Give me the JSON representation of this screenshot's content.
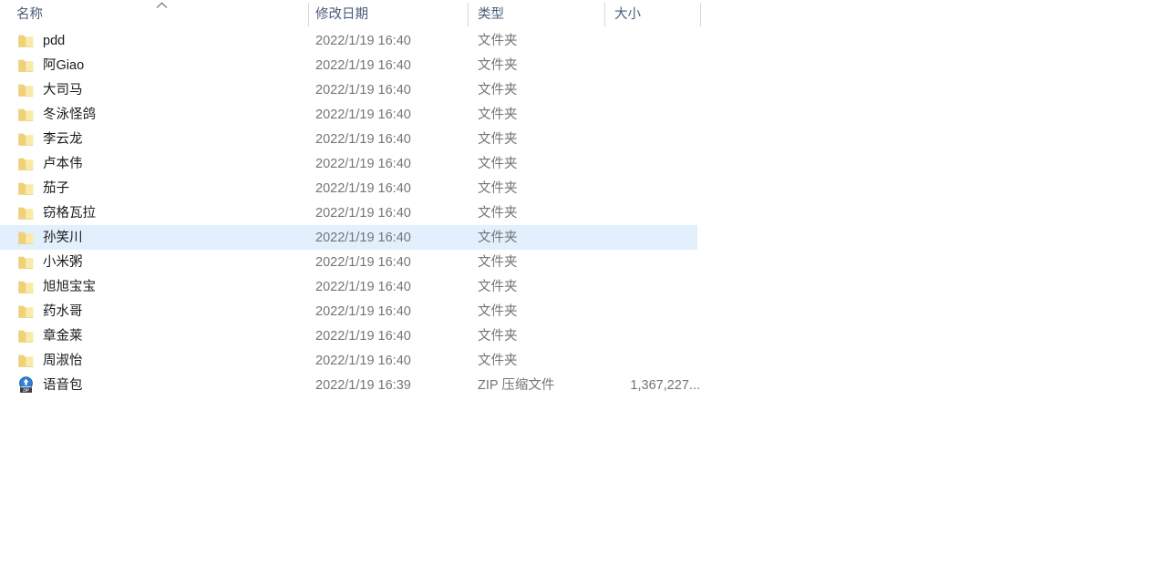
{
  "view": {
    "name": "details-list-view",
    "background_color": "#ffffff",
    "selection_color": "#e2effc",
    "header_text_color": "#4b5c78",
    "name_text_color": "#191919",
    "meta_text_color": "#757575",
    "folder_icon_color": "#f5d97b",
    "zip_icon_color": "#1f6fd0"
  },
  "columns": [
    {
      "key": "name",
      "label": "名称",
      "sorted": true,
      "sort_direction": "ascending",
      "sort_glyph": "chevron-up"
    },
    {
      "key": "date_modified",
      "label": "修改日期",
      "sorted": false,
      "sort_direction": "",
      "sort_glyph": ""
    },
    {
      "key": "type",
      "label": "类型",
      "sorted": false,
      "sort_direction": "",
      "sort_glyph": ""
    },
    {
      "key": "size",
      "label": "大小",
      "sorted": false,
      "sort_direction": "",
      "sort_glyph": ""
    }
  ],
  "rows": [
    {
      "icon": "folder-icon",
      "name": "pdd",
      "date_modified": "2022/1/19 16:40",
      "type": "文件夹",
      "size": "",
      "selected": false
    },
    {
      "icon": "folder-icon",
      "name": "阿Giao",
      "date_modified": "2022/1/19 16:40",
      "type": "文件夹",
      "size": "",
      "selected": false
    },
    {
      "icon": "folder-icon",
      "name": "大司马",
      "date_modified": "2022/1/19 16:40",
      "type": "文件夹",
      "size": "",
      "selected": false
    },
    {
      "icon": "folder-icon",
      "name": "冬泳怪鸽",
      "date_modified": "2022/1/19 16:40",
      "type": "文件夹",
      "size": "",
      "selected": false
    },
    {
      "icon": "folder-icon",
      "name": "李云龙",
      "date_modified": "2022/1/19 16:40",
      "type": "文件夹",
      "size": "",
      "selected": false
    },
    {
      "icon": "folder-icon",
      "name": "卢本伟",
      "date_modified": "2022/1/19 16:40",
      "type": "文件夹",
      "size": "",
      "selected": false
    },
    {
      "icon": "folder-icon",
      "name": "茄子",
      "date_modified": "2022/1/19 16:40",
      "type": "文件夹",
      "size": "",
      "selected": false
    },
    {
      "icon": "folder-icon",
      "name": "窃格瓦拉",
      "date_modified": "2022/1/19 16:40",
      "type": "文件夹",
      "size": "",
      "selected": false
    },
    {
      "icon": "folder-icon",
      "name": "孙笑川",
      "date_modified": "2022/1/19 16:40",
      "type": "文件夹",
      "size": "",
      "selected": true
    },
    {
      "icon": "folder-icon",
      "name": "小米粥",
      "date_modified": "2022/1/19 16:40",
      "type": "文件夹",
      "size": "",
      "selected": false
    },
    {
      "icon": "folder-icon",
      "name": "旭旭宝宝",
      "date_modified": "2022/1/19 16:40",
      "type": "文件夹",
      "size": "",
      "selected": false
    },
    {
      "icon": "folder-icon",
      "name": "药水哥",
      "date_modified": "2022/1/19 16:40",
      "type": "文件夹",
      "size": "",
      "selected": false
    },
    {
      "icon": "folder-icon",
      "name": "章金莱",
      "date_modified": "2022/1/19 16:40",
      "type": "文件夹",
      "size": "",
      "selected": false
    },
    {
      "icon": "folder-icon",
      "name": "周淑怡",
      "date_modified": "2022/1/19 16:40",
      "type": "文件夹",
      "size": "",
      "selected": false
    },
    {
      "icon": "zip-archive-icon",
      "name": "语音包",
      "date_modified": "2022/1/19 16:39",
      "type": "ZIP 压缩文件",
      "size": "1,367,227...",
      "selected": false
    }
  ]
}
